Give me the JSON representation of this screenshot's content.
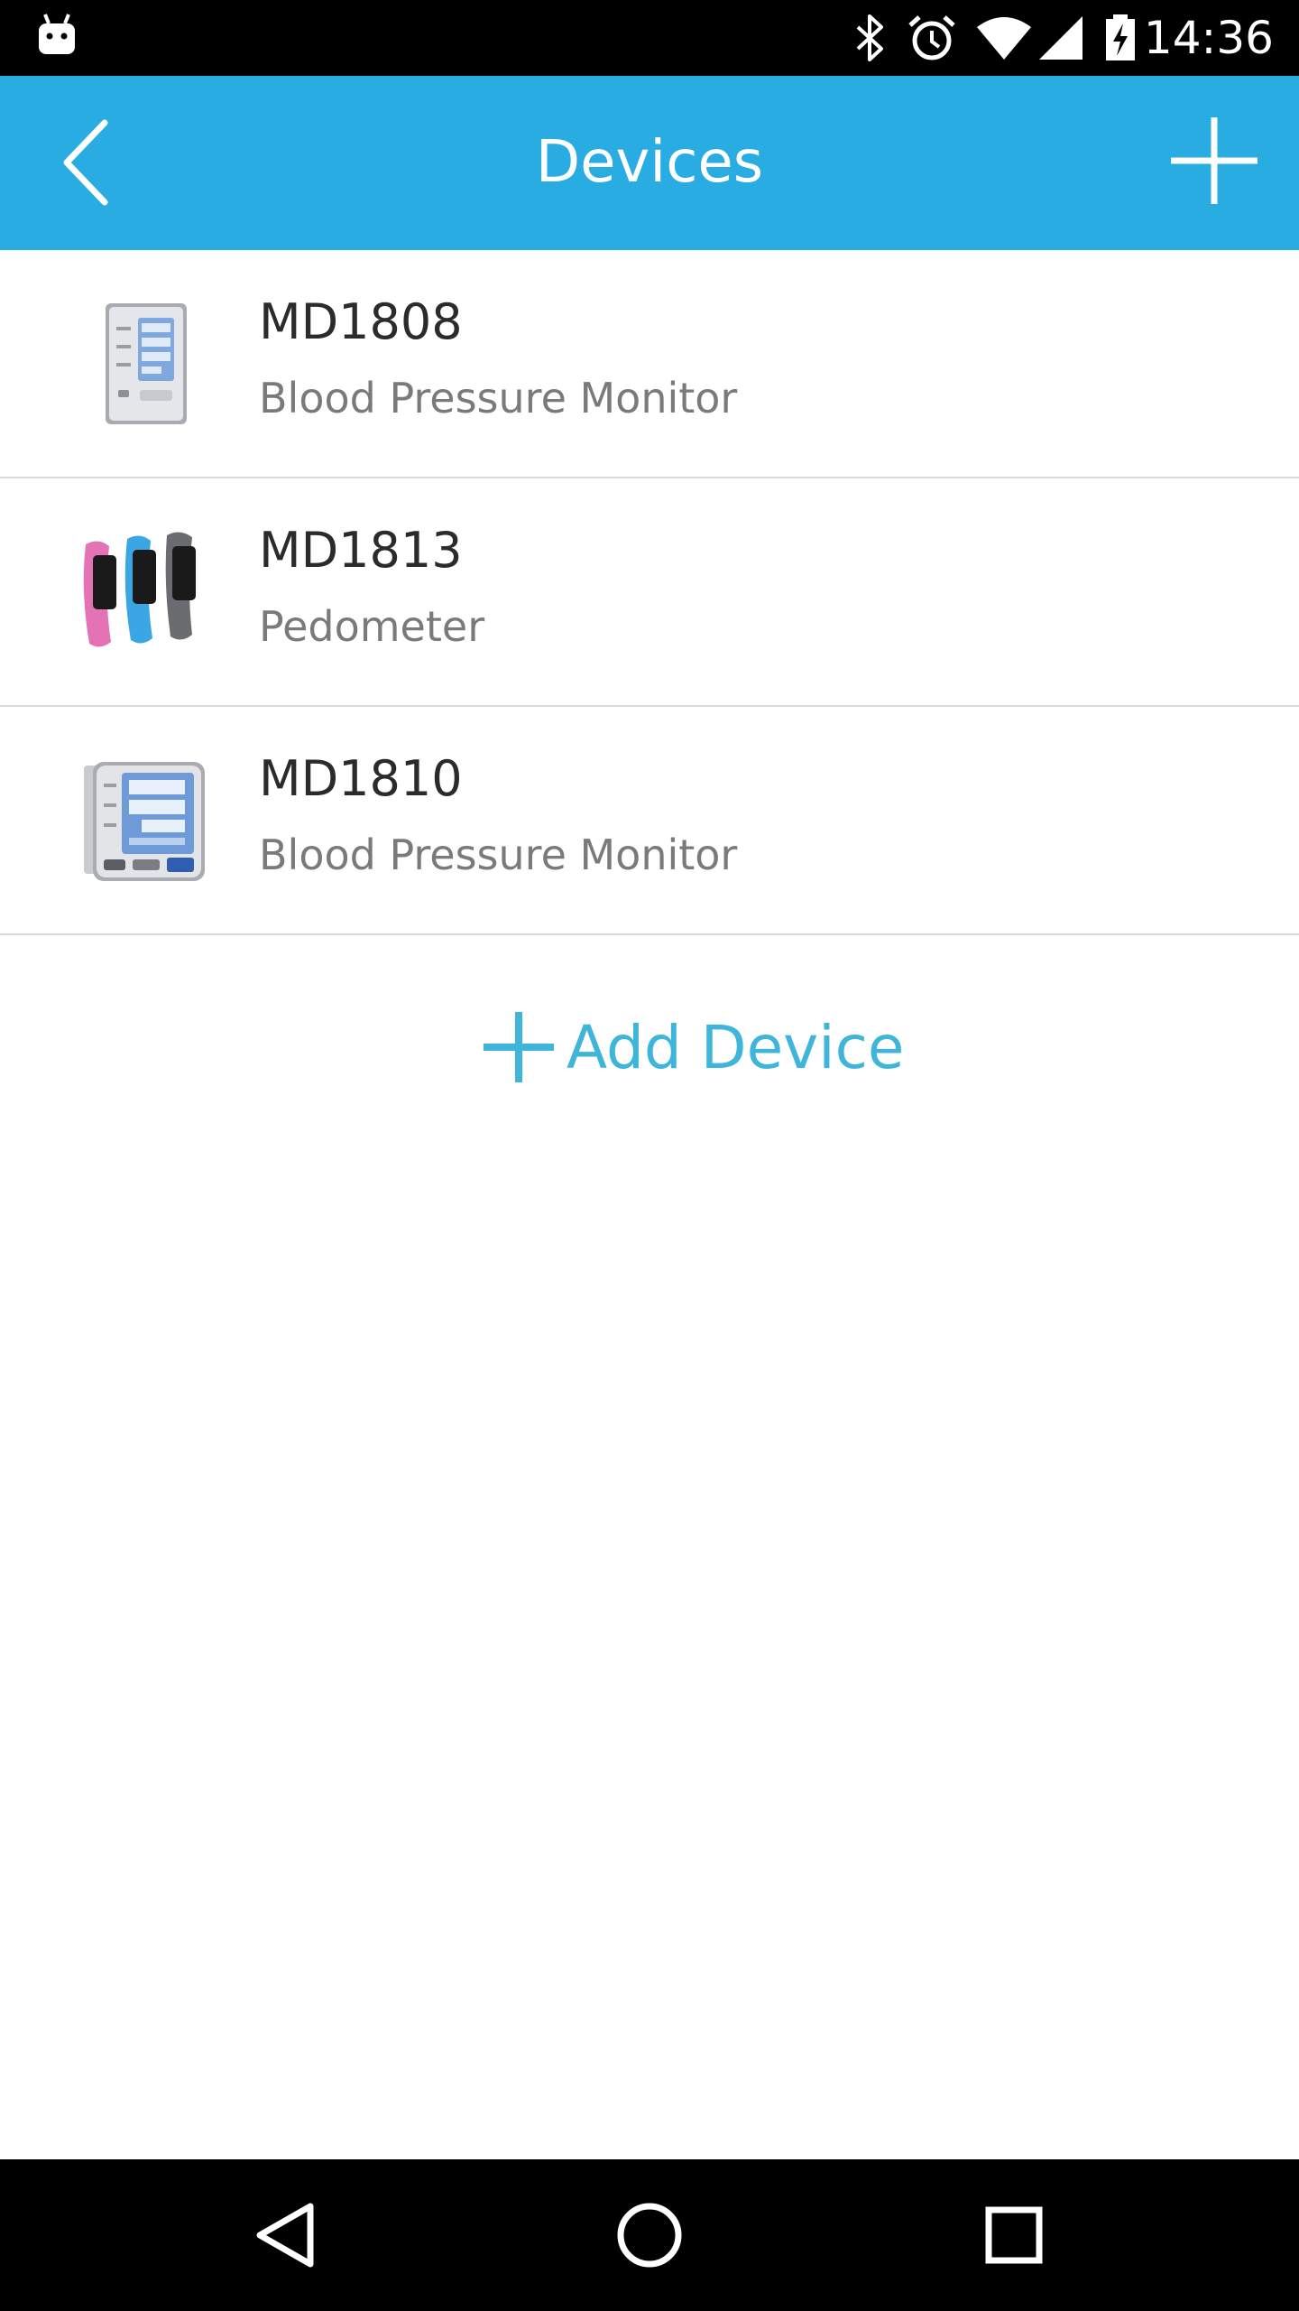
{
  "status_bar": {
    "time": "14:36",
    "icons": [
      "android-icon",
      "bluetooth-icon",
      "alarm-icon",
      "wifi-icon",
      "signal-icon",
      "battery-charging-icon"
    ]
  },
  "app_bar": {
    "title": "Devices",
    "back_icon": "chevron-left-icon",
    "add_icon": "plus-icon"
  },
  "devices": [
    {
      "name": "MD1808",
      "type": "Blood Pressure Monitor",
      "image": "upper-arm-bp-monitor"
    },
    {
      "name": "MD1813",
      "type": "Pedometer",
      "image": "fitness-bands"
    },
    {
      "name": "MD1810",
      "type": "Blood Pressure Monitor",
      "image": "wrist-bp-monitor"
    }
  ],
  "add_device": {
    "label": "Add Device",
    "icon": "plus-icon"
  },
  "nav_bar": {
    "icons": [
      "nav-back-icon",
      "nav-home-icon",
      "nav-recents-icon"
    ]
  },
  "colors": {
    "app_bar": "#29ace2",
    "accent_text": "#3fb5da",
    "divider": "#d9d9d9",
    "primary_text": "#2b2b2b",
    "secondary_text": "#7a7a7a"
  }
}
